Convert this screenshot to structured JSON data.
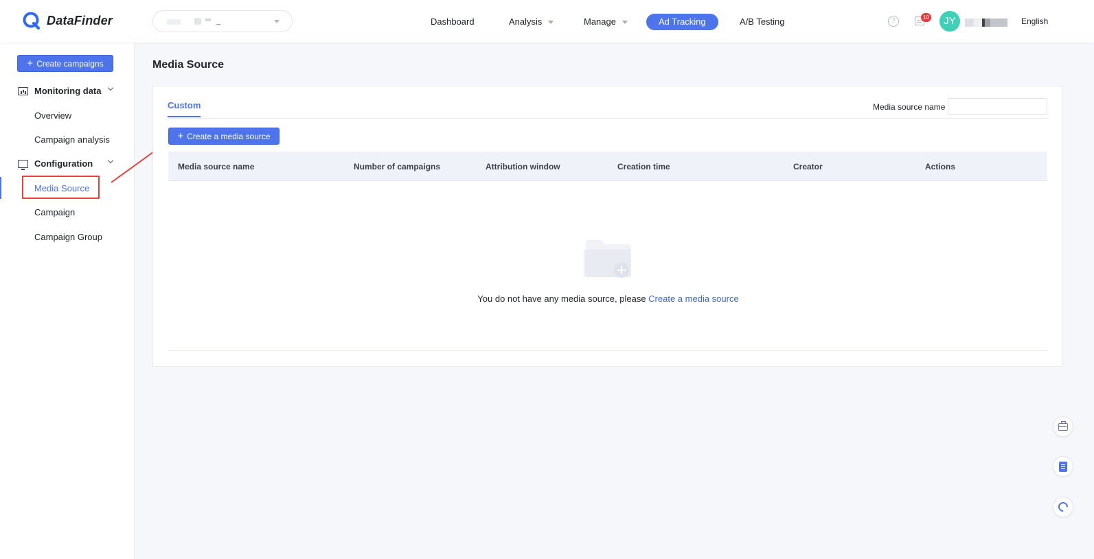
{
  "app": {
    "logo_text": "DataFinder"
  },
  "header": {
    "nav": [
      {
        "label": "Dashboard",
        "has_caret": false
      },
      {
        "label": "Analysis",
        "has_caret": true
      },
      {
        "label": "Manage",
        "has_caret": true
      },
      {
        "label": "Ad Tracking",
        "active": true
      },
      {
        "label": "A/B Testing",
        "has_caret": false
      }
    ],
    "help_icon_glyph": "?",
    "notification_count": "10",
    "avatar_initials": "JY",
    "language": "English"
  },
  "sidebar": {
    "create_button": "Create campaigns",
    "groups": [
      {
        "label": "Monitoring data",
        "icon": "monitoring-icon",
        "items": [
          "Overview",
          "Campaign analysis"
        ]
      },
      {
        "label": "Configuration",
        "icon": "configuration-icon",
        "items": [
          "Media Source",
          "Campaign",
          "Campaign Group"
        ]
      }
    ],
    "active_item": "Media Source"
  },
  "main": {
    "title": "Media Source",
    "tab": "Custom",
    "filter": {
      "label": "Media source name",
      "value": "",
      "placeholder": ""
    },
    "create_button": "Create a media source",
    "table": {
      "columns": [
        "Media source name",
        "Number of campaigns",
        "Attribution window",
        "Creation time",
        "Creator",
        "Actions"
      ],
      "rows": []
    },
    "empty_state": {
      "text": "You do not have any media source, please ",
      "link": "Create a media source"
    }
  },
  "floating_tools": [
    "toolbox-icon",
    "document-icon",
    "headset-icon"
  ],
  "colors": {
    "primary": "#4e74ec",
    "avatar": "#3ed1b7",
    "badge": "#ec3a3a",
    "annotation": "#e8403b"
  }
}
